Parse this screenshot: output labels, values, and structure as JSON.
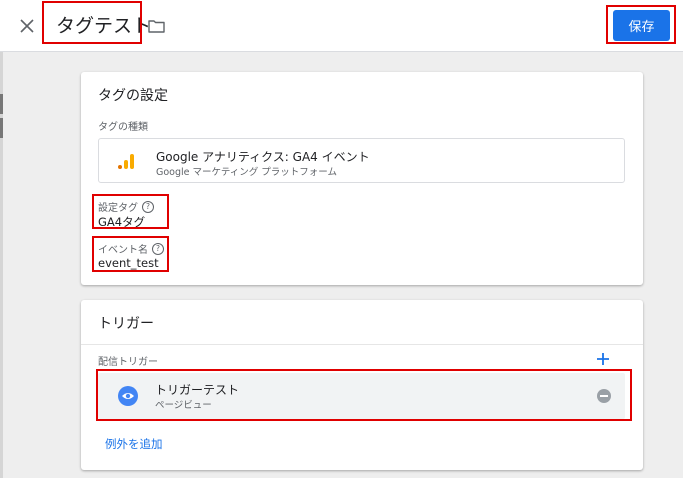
{
  "header": {
    "title": "タグテスト",
    "save_label": "保存"
  },
  "tag_config": {
    "card_title": "タグの設定",
    "type_label": "タグの種類",
    "type_name": "Google アナリティクス: GA4 イベント",
    "type_platform": "Google マーケティング プラットフォーム",
    "config_tag_label": "設定タグ",
    "config_tag_value": "GA4タグ",
    "event_name_label": "イベント名",
    "event_name_value": "event_test"
  },
  "triggers": {
    "card_title": "トリガー",
    "firing_label": "配信トリガー",
    "items": [
      {
        "name": "トリガーテスト",
        "type": "ページビュー"
      }
    ],
    "add_exception_label": "例外を追加"
  },
  "icons": {
    "close": "close-icon",
    "folder": "folder-icon",
    "analytics": "google-analytics-icon",
    "help": "help-icon",
    "add": "plus-icon",
    "pageview": "eye-icon",
    "remove": "remove-icon"
  },
  "colors": {
    "primary": "#1a73e8",
    "highlight": "#e00000",
    "pageview_icon": "#4285f4",
    "ga_orange": "#f9ab00",
    "ga_dark_orange": "#e37400"
  }
}
